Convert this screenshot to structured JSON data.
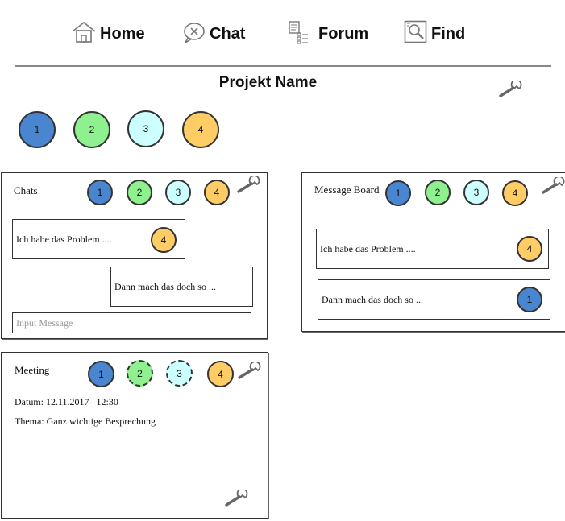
{
  "nav": {
    "home": "Home",
    "chat": "Chat",
    "forum": "Forum",
    "find": "Find"
  },
  "project": {
    "title": "Projekt Name"
  },
  "members": [
    "1",
    "2",
    "3",
    "4"
  ],
  "colors": {
    "member1": "#4a86d0",
    "member2": "#8ef08e",
    "member3": "#ccffff",
    "member4": "#ffcc66"
  },
  "chats": {
    "title": "Chats",
    "members": [
      "1",
      "2",
      "3",
      "4"
    ],
    "messages": [
      {
        "text": "Ich habe das Problem ....",
        "author": "4"
      },
      {
        "text": "Dann mach das doch so ..."
      }
    ],
    "input_placeholder": "Input Message"
  },
  "board": {
    "title": "Message Board",
    "members": [
      "1",
      "2",
      "3",
      "4"
    ],
    "messages": [
      {
        "text": "Ich habe das Problem ....",
        "author": "4"
      },
      {
        "text": "Dann mach das doch so ...",
        "author": "1"
      }
    ]
  },
  "meeting": {
    "title": "Meeting",
    "members": [
      "1",
      "2",
      "3",
      "4"
    ],
    "date_line": "Datum: 12.11.2017   12:30",
    "topic_line": "Thema: Ganz wichtige Besprechung"
  }
}
